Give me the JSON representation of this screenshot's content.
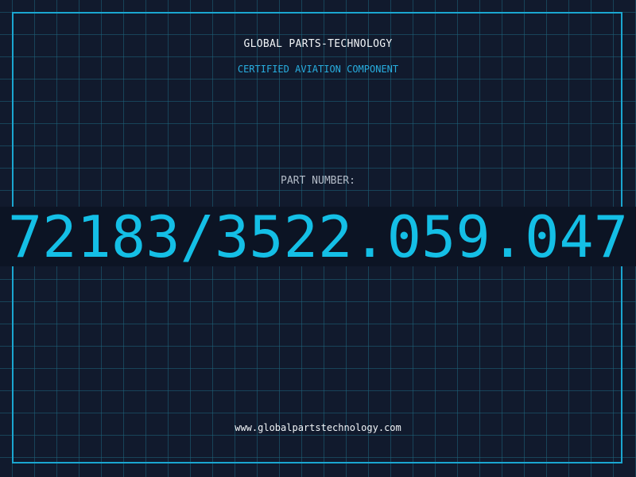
{
  "header": {
    "brand": "GLOBAL PARTS-TECHNOLOGY",
    "tagline": "CERTIFIED AVIATION COMPONENT"
  },
  "part": {
    "label": "PART NUMBER:",
    "number": "72183/3522.059.047"
  },
  "footer": {
    "website": "www.globalpartstechnology.com"
  },
  "colors": {
    "background": "#111a2d",
    "grid": "#1e647d",
    "accent": "#14bfe6",
    "text": "#f2f5f8"
  }
}
